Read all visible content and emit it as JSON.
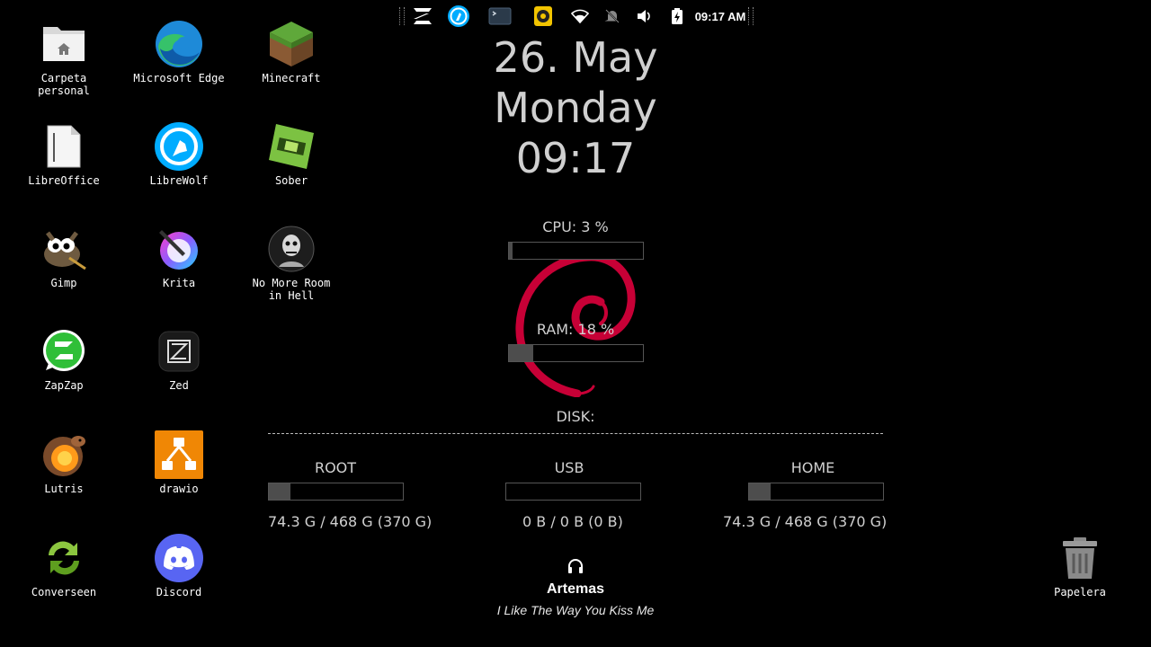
{
  "tray": {
    "clock": "09:17 AM",
    "icons": [
      "zorin-menu-icon",
      "librewolf-tray-icon",
      "terminal-icon",
      "audio-player-icon",
      "wifi-icon",
      "notifications-muted-icon",
      "volume-icon",
      "battery-charging-icon"
    ]
  },
  "desktop_icons": [
    {
      "label": "Carpeta\npersonal",
      "icon": "home-folder-icon"
    },
    {
      "label": "Microsoft Edge",
      "icon": "edge-icon"
    },
    {
      "label": "Minecraft",
      "icon": "minecraft-icon"
    },
    {
      "label": "LibreOffice",
      "icon": "libreoffice-icon"
    },
    {
      "label": "LibreWolf",
      "icon": "librewolf-icon"
    },
    {
      "label": "Sober",
      "icon": "sober-icon"
    },
    {
      "label": "Gimp",
      "icon": "gimp-icon"
    },
    {
      "label": "Krita",
      "icon": "krita-icon"
    },
    {
      "label": "No More Room\nin Hell",
      "icon": "nmrih-icon"
    },
    {
      "label": "ZapZap",
      "icon": "zapzap-icon"
    },
    {
      "label": "Zed",
      "icon": "zed-icon"
    },
    {
      "label": "Lutris",
      "icon": "lutris-icon"
    },
    {
      "label": "drawio",
      "icon": "drawio-icon"
    },
    {
      "label": "Converseen",
      "icon": "converseen-icon"
    },
    {
      "label": "Discord",
      "icon": "discord-icon"
    },
    {
      "label": "Papelera",
      "icon": "trash-icon"
    }
  ],
  "conky": {
    "date": "26. May",
    "weekday": "Monday",
    "time": "09:17",
    "cpu_label": "CPU: 3 %",
    "cpu_percent": 3,
    "ram_label": "RAM: 18 %",
    "ram_percent": 18,
    "disk_label": "DISK:",
    "disks": [
      {
        "name": "ROOT",
        "usage": "74.3 G / 468 G (370 G)",
        "percent": 15.9
      },
      {
        "name": "USB",
        "usage": "0 B / 0 B (0 B)",
        "percent": 0
      },
      {
        "name": "HOME",
        "usage": "74.3 G / 468 G (370 G)",
        "percent": 15.9
      }
    ]
  },
  "music": {
    "artist": "Artemas",
    "track": "I Like The Way You Kiss Me"
  },
  "colors": {
    "background": "#000000",
    "debian_red": "#c70036",
    "bar_fill": "#4d4d4d",
    "edge_blue": "#1e8ad8",
    "discord_blurple": "#5865f2"
  }
}
